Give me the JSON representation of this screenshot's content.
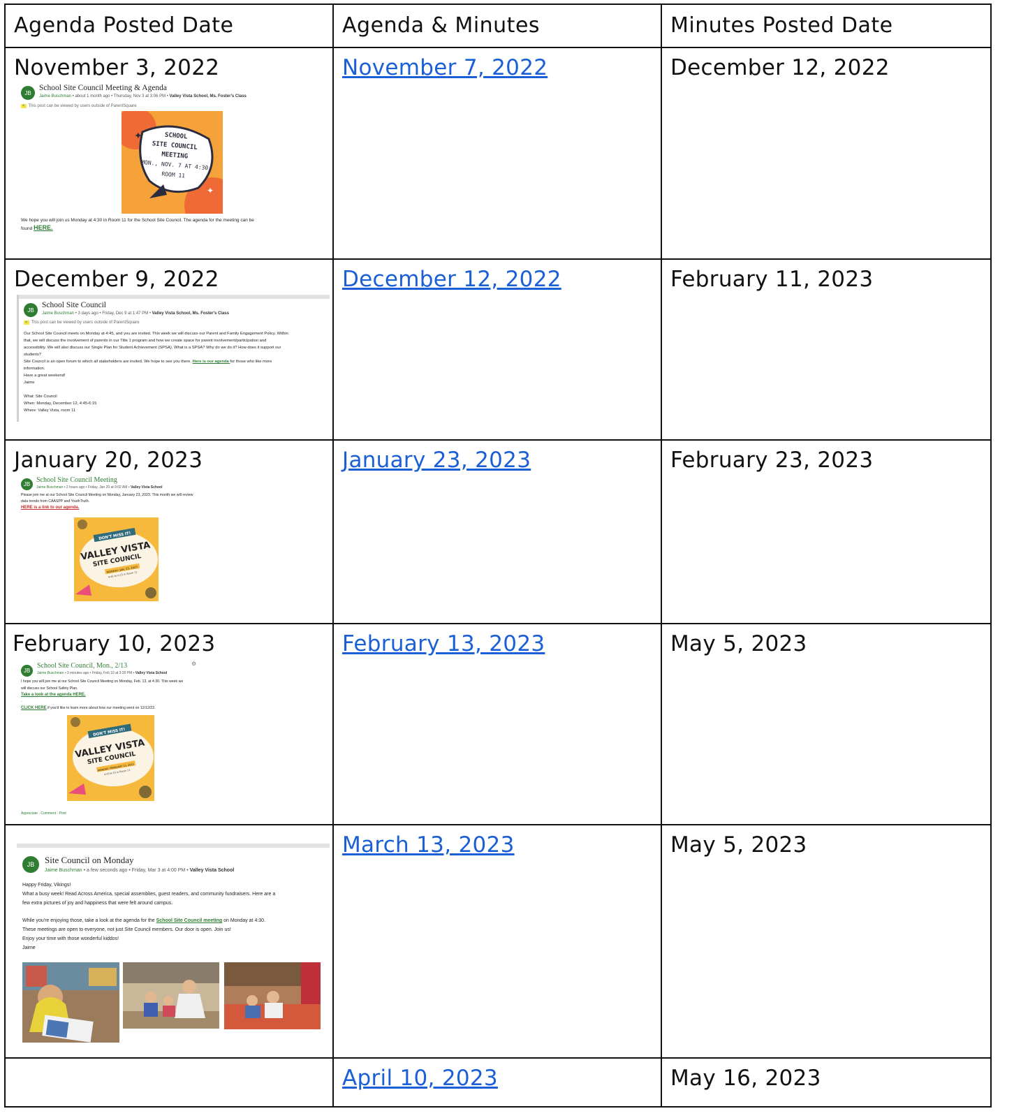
{
  "headers": [
    "Agenda Posted Date",
    "Agenda & Minutes",
    "Minutes Posted Date"
  ],
  "rows": [
    {
      "posted": "November 3, 2022",
      "meeting": "November 7, 2022",
      "minutes": "December 12, 2022",
      "post": {
        "avatar": "JB",
        "title": "School Site Council Meeting & Agenda",
        "author": "Jaime Buschman",
        "meta": " • about 1 month ago • Thursday, Nov 3 at 3:06 PM • ",
        "group": "Valley Vista School, Ms. Foster's Class",
        "notice": "This post can be viewed by users outside of ParentSquare",
        "flyer_lines": [
          "SCHOOL",
          "SITE COUNCIL",
          "MEETING",
          "MON., NOV. 7 AT 4:30",
          "ROOM 11"
        ],
        "body": "We hope you will join us Monday at 4:30 in Room 11 for the School Site Council. The agenda for the meeting can be",
        "body2": "found ",
        "link": "HERE."
      }
    },
    {
      "posted": "December 9, 2022",
      "meeting": "December 12, 2022",
      "minutes": "February 11, 2023",
      "post": {
        "avatar": "JB",
        "title": "School Site Council",
        "author": "Jaime Buschman",
        "meta": " • 3 days ago • Friday, Dec 9 at 1:47 PM • ",
        "group": "Valley Vista School, Ms. Foster's Class",
        "notice": "This post can be viewed by users outside of ParentSquare",
        "lines": [
          "Our School Site Council meets on Monday at 4:45, and you are invited. This week we will discuss our Parent and Family Engagement Policy.  Within",
          "that, we will discuss the involvement of parents in our Title 1 program and how we create space for parent involvement/participation and",
          "accessibility.  We will also discuss our Single Plan for Student Achievement (SPSA). What is a SPSA? Why do we do it? How does it support our",
          "students?"
        ],
        "line5a": "Site Council is an open forum to which all stakeholders are invited. We hope to see you there. ",
        "line5link": "Here is our agenda ",
        "line5b": "for those who like more",
        "line6": "information.",
        "line7": "Have a great weekend!",
        "line8": "Jaime",
        "what": "What: Site Council",
        "when": "When: Monday, December 12, 4:45-6:15",
        "where": "Where: Valley Vista, room 11"
      }
    },
    {
      "posted": "January 20, 2023",
      "meeting": "January 23, 2023",
      "minutes": "February 23, 2023",
      "post": {
        "avatar": "JB",
        "title": "School Site Council Meeting",
        "author": "Jaime Buschman",
        "meta": " • 2 hours ago • Friday, Jan 20 at 9:02 AM • ",
        "group": "Valley Vista School",
        "line1": "Please join me at our School Site Council Meeting on Monday, January 23, 2023. This month we will review",
        "line2": "data trends from CAASPP and YouthTruth.",
        "link": "HERE is a link to our agenda.",
        "flyer_badge": "DON'T MISS IT!",
        "flyer_title": "VALLEY VISTA",
        "flyer_sub": "SITE COUNCIL",
        "flyer_date": "MONDAY, JAN. 23, 2023",
        "flyer_time": "4:45 to 6:15 in Room 11"
      }
    },
    {
      "posted": "February 10, 2023",
      "meeting": "February 13, 2023",
      "minutes": "May 5, 2023",
      "post": {
        "avatar": "JB",
        "title": "School Site Council, Mon., 2/13",
        "author": "Jaime Buschman",
        "meta": " • 3 minutes ago • Friday, Feb 10 at 3:35 PM • ",
        "group": "Valley Vista School",
        "line1": "I hope you will join me at our School Site Council Meeting on Monday, Feb. 13, at 4:30. This week we",
        "line2": "will discuss our School Safety Plan.",
        "link1": "Take a look at the agenda HERE.",
        "link2": "CLICK HERE",
        "line3": " if you'd like to learn more about how our meeting went on 12/12/22.",
        "flyer_badge": "DON'T MISS IT!",
        "flyer_title": "VALLEY VISTA",
        "flyer_sub": "SITE COUNCIL",
        "flyer_date": "MONDAY, FEBRUARY 13, 2023",
        "flyer_time": "4:45-6:15 in Room 11",
        "actions": "Appreciate  ·  Comment  ·  Print"
      }
    },
    {
      "posted": "",
      "meeting": "March 13, 2023",
      "minutes": "May 5, 2023",
      "post": {
        "avatar": "JB",
        "title": "Site Council on Monday",
        "author": "Jaime Buschman",
        "meta": " • a few seconds ago • Friday, Mar 3 at 4:00 PM • ",
        "group": "Valley Vista School",
        "l1": "Happy Friday, Vikings!",
        "l2": "What a busy week! Read Across America, special assemblies, guest readers, and community fundraisers. Here are a",
        "l3": "few extra pictures of joy and happiness that were felt around campus.",
        "l4a": "While you're enjoying those, take a look at the agenda for the ",
        "l4link": "School Site Council meeting",
        "l4b": " on Monday at 4:30.",
        "l5": "These meetings are open to everyone, not just Site Council members. Our door is open. Join us!",
        "l6": "Enjoy your time with those wonderful kiddos!",
        "l7": "Jaime"
      }
    },
    {
      "posted": "",
      "meeting": "April 10, 2023",
      "minutes": "May 16, 2023"
    }
  ]
}
